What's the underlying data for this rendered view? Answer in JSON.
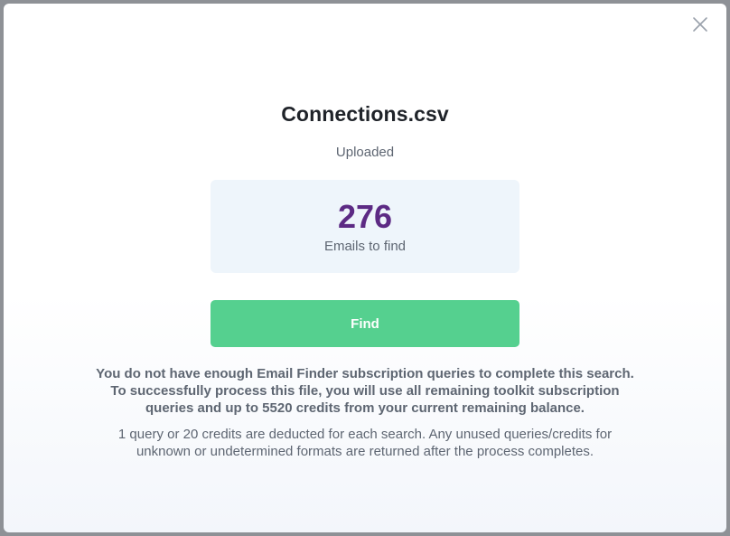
{
  "dialog": {
    "file_name": "Connections.csv",
    "status": "Uploaded",
    "count": {
      "value": "276",
      "label": "Emails to find"
    },
    "find_button_label": "Find",
    "warning_lines": [
      "You do not have enough Email Finder subscription queries to complete this search.",
      "To successfully process this file, you will use all remaining toolkit subscription",
      "queries and up to 5520 credits from your current remaining balance."
    ],
    "note_lines": [
      "1 query or 20 credits are deducted for each search. Any unused queries/credits for",
      "unknown or undetermined formats are returned after the process completes."
    ],
    "close_icon": "close-icon"
  },
  "colors": {
    "accent_green": "#55d08f",
    "count_purple": "#5c2a84",
    "card_background": "#eef5fb",
    "text_muted": "#5e6672",
    "title_text": "#1f2329"
  }
}
